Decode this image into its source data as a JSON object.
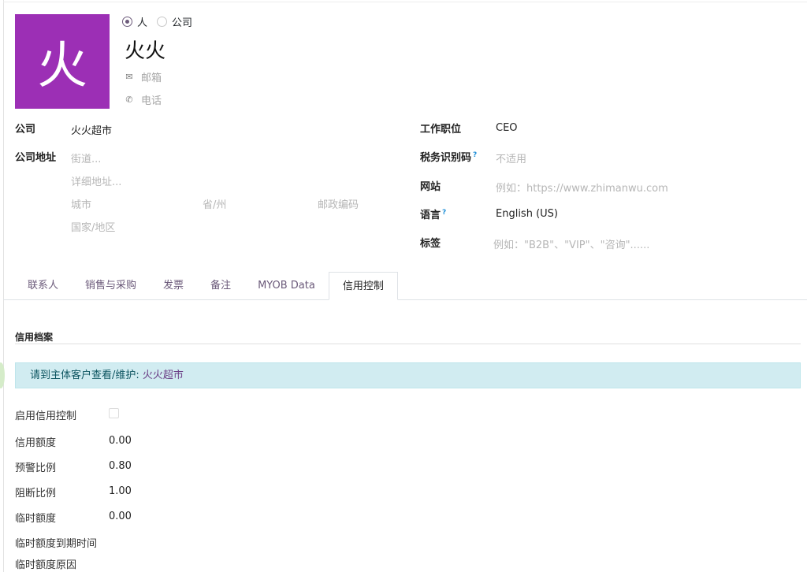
{
  "avatar": {
    "initial": "火",
    "color": "#9c2fb5"
  },
  "type_options": {
    "person": "人",
    "company": "公司",
    "selected": "person"
  },
  "name": "火火",
  "contact": {
    "email_placeholder": "邮箱",
    "phone_placeholder": "电话"
  },
  "left_fields": {
    "company_label": "公司",
    "company_value": "火火超市",
    "address_label": "公司地址",
    "street_placeholder": "街道...",
    "street2_placeholder": "详细地址...",
    "city_placeholder": "城市",
    "state_placeholder": "省/州",
    "zip_placeholder": "邮政编码",
    "country_placeholder": "国家/地区"
  },
  "right_fields": {
    "job_label": "工作职位",
    "job_value": "CEO",
    "tax_label": "税务识别码",
    "tax_placeholder": "不适用",
    "website_label": "网站",
    "website_placeholder": "例如：https://www.zhimanwu.com",
    "lang_label": "语言",
    "lang_value": "English (US)",
    "tags_label": "标签",
    "tags_placeholder": "例如：\"B2B\"、\"VIP\"、\"咨询\"......",
    "help_mark": "?"
  },
  "tabs": [
    "联系人",
    "销售与采购",
    "发票",
    "备注",
    "MYOB Data",
    "信用控制"
  ],
  "active_tab": "信用控制",
  "credit": {
    "section_title": "信用档案",
    "alert_text": "请到主体客户查看/维护: ",
    "alert_link": "火火超市",
    "enable_label": "启用信用控制",
    "limit_label": "信用额度",
    "limit_value": "0.00",
    "warn_label": "预警比例",
    "warn_value": "0.80",
    "block_label": "阻断比例",
    "block_value": "1.00",
    "temp_label": "临时额度",
    "temp_value": "0.00",
    "temp_expiry_label": "临时额度到期时间",
    "temp_reason_label": "临时额度原因"
  }
}
